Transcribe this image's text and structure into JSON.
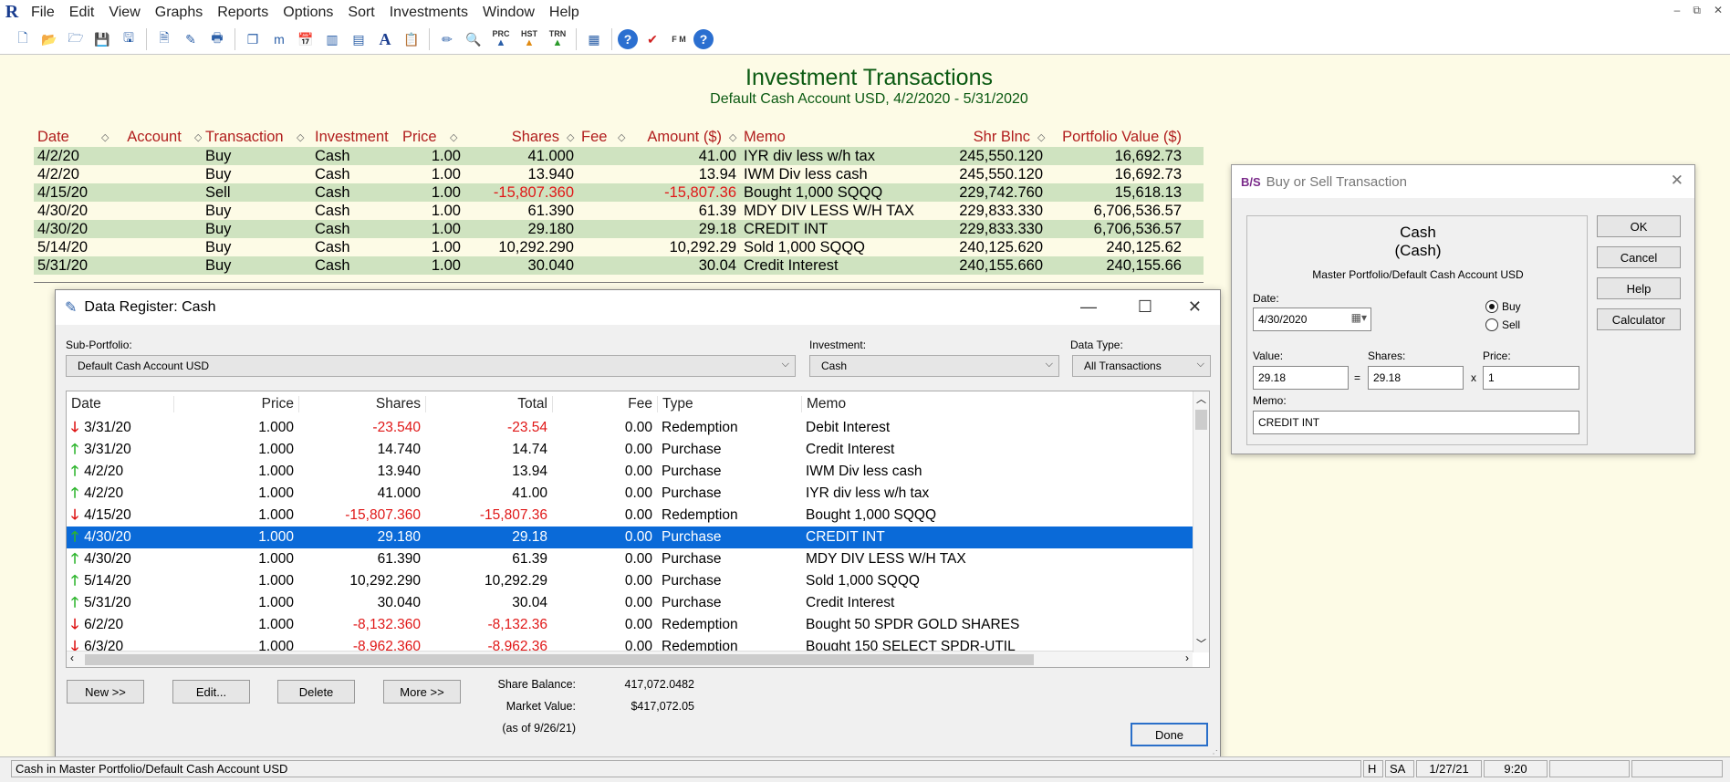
{
  "app": {
    "logo": "R",
    "menu": [
      "File",
      "Edit",
      "View",
      "Graphs",
      "Reports",
      "Options",
      "Sort",
      "Investments",
      "Window",
      "Help"
    ],
    "window_controls": [
      "–",
      "⧉",
      "✕"
    ]
  },
  "toolbar": {
    "labels": [
      "PRC",
      "HST",
      "TRN"
    ],
    "fm_label": "F M"
  },
  "report": {
    "title": "Investment Transactions",
    "subtitle": "Default Cash Account USD, 4/2/2020 - 5/31/2020",
    "columns": [
      "Date",
      "Account",
      "Transaction",
      "Investment",
      "Price",
      "Shares",
      "Fee",
      "Amount ($)",
      "Memo",
      "Shr Blnc",
      "Portfolio Value ($)"
    ],
    "rows": [
      {
        "date": "4/2/20",
        "account": "",
        "transaction": "Buy",
        "investment": "Cash",
        "price": "1.00",
        "shares": "41.000",
        "fee": "",
        "amount": "41.00",
        "memo": "IYR div less w/h tax",
        "shr_blnc": "245,550.120",
        "portfolio_value": "16,692.73"
      },
      {
        "date": "4/2/20",
        "account": "",
        "transaction": "Buy",
        "investment": "Cash",
        "price": "1.00",
        "shares": "13.940",
        "fee": "",
        "amount": "13.94",
        "memo": "IWM Div less cash",
        "shr_blnc": "245,550.120",
        "portfolio_value": "16,692.73"
      },
      {
        "date": "4/15/20",
        "account": "",
        "transaction": "Sell",
        "investment": "Cash",
        "price": "1.00",
        "shares": "-15,807.360",
        "fee": "",
        "amount": "-15,807.36",
        "memo": "Bought 1,000 SQQQ",
        "shr_blnc": "229,742.760",
        "portfolio_value": "15,618.13"
      },
      {
        "date": "4/30/20",
        "account": "",
        "transaction": "Buy",
        "investment": "Cash",
        "price": "1.00",
        "shares": "61.390",
        "fee": "",
        "amount": "61.39",
        "memo": "MDY DIV LESS W/H TAX",
        "shr_blnc": "229,833.330",
        "portfolio_value": "6,706,536.57"
      },
      {
        "date": "4/30/20",
        "account": "",
        "transaction": "Buy",
        "investment": "Cash",
        "price": "1.00",
        "shares": "29.180",
        "fee": "",
        "amount": "29.18",
        "memo": "CREDIT INT",
        "shr_blnc": "229,833.330",
        "portfolio_value": "6,706,536.57"
      },
      {
        "date": "5/14/20",
        "account": "",
        "transaction": "Buy",
        "investment": "Cash",
        "price": "1.00",
        "shares": "10,292.290",
        "fee": "",
        "amount": "10,292.29",
        "memo": "Sold 1,000 SQQQ",
        "shr_blnc": "240,125.620",
        "portfolio_value": "240,125.62"
      },
      {
        "date": "5/31/20",
        "account": "",
        "transaction": "Buy",
        "investment": "Cash",
        "price": "1.00",
        "shares": "30.040",
        "fee": "",
        "amount": "30.04",
        "memo": "Credit Interest",
        "shr_blnc": "240,155.660",
        "portfolio_value": "240,155.66"
      }
    ]
  },
  "register": {
    "title": "Data Register: Cash",
    "sub_portfolio_label": "Sub-Portfolio:",
    "sub_portfolio_value": "Default Cash Account USD",
    "investment_label": "Investment:",
    "investment_value": "Cash",
    "data_type_label": "Data Type:",
    "data_type_value": "All Transactions",
    "columns": [
      "Date",
      "Price",
      "Shares",
      "Total",
      "Fee",
      "Type",
      "Memo"
    ],
    "rows": [
      {
        "dir": "down",
        "date": "3/31/20",
        "price": "1.000",
        "shares": "-23.540",
        "total": "-23.54",
        "fee": "0.00",
        "type": "Redemption",
        "memo": "Debit Interest"
      },
      {
        "dir": "up",
        "date": "3/31/20",
        "price": "1.000",
        "shares": "14.740",
        "total": "14.74",
        "fee": "0.00",
        "type": "Purchase",
        "memo": "Credit Interest"
      },
      {
        "dir": "up",
        "date": "4/2/20",
        "price": "1.000",
        "shares": "13.940",
        "total": "13.94",
        "fee": "0.00",
        "type": "Purchase",
        "memo": "IWM Div less cash"
      },
      {
        "dir": "up",
        "date": "4/2/20",
        "price": "1.000",
        "shares": "41.000",
        "total": "41.00",
        "fee": "0.00",
        "type": "Purchase",
        "memo": "IYR div less w/h tax"
      },
      {
        "dir": "down",
        "date": "4/15/20",
        "price": "1.000",
        "shares": "-15,807.360",
        "total": "-15,807.36",
        "fee": "0.00",
        "type": "Redemption",
        "memo": "Bought 1,000 SQQQ"
      },
      {
        "dir": "up",
        "date": "4/30/20",
        "price": "1.000",
        "shares": "29.180",
        "total": "29.18",
        "fee": "0.00",
        "type": "Purchase",
        "memo": "CREDIT INT",
        "selected": true
      },
      {
        "dir": "up",
        "date": "4/30/20",
        "price": "1.000",
        "shares": "61.390",
        "total": "61.39",
        "fee": "0.00",
        "type": "Purchase",
        "memo": "MDY DIV LESS W/H TAX"
      },
      {
        "dir": "up",
        "date": "5/14/20",
        "price": "1.000",
        "shares": "10,292.290",
        "total": "10,292.29",
        "fee": "0.00",
        "type": "Purchase",
        "memo": "Sold 1,000 SQQQ"
      },
      {
        "dir": "up",
        "date": "5/31/20",
        "price": "1.000",
        "shares": "30.040",
        "total": "30.04",
        "fee": "0.00",
        "type": "Purchase",
        "memo": "Credit Interest"
      },
      {
        "dir": "down",
        "date": "6/2/20",
        "price": "1.000",
        "shares": "-8,132.360",
        "total": "-8,132.36",
        "fee": "0.00",
        "type": "Redemption",
        "memo": "Bought 50 SPDR GOLD SHARES"
      },
      {
        "dir": "down",
        "date": "6/3/20",
        "price": "1.000",
        "shares": "-8,962.360",
        "total": "-8,962.36",
        "fee": "0.00",
        "type": "Redemption",
        "memo": "Bought 150 SELECT SPDR-UTIL"
      }
    ],
    "buttons": {
      "new": "New >>",
      "edit": "Edit...",
      "delete": "Delete",
      "more": "More >>",
      "done": "Done"
    },
    "share_balance_label": "Share Balance:",
    "share_balance_value": "417,072.0482",
    "market_value_label": "Market Value:",
    "market_value_value": "$417,072.05",
    "as_of": "(as of 9/26/21)"
  },
  "buysell": {
    "title": "Buy or Sell Transaction",
    "heading": "Cash",
    "subheading": "(Cash)",
    "account": "Master Portfolio/Default Cash Account USD",
    "date_label": "Date:",
    "date_value": "4/30/2020",
    "buy_label": "Buy",
    "sell_label": "Sell",
    "selected": "Buy",
    "value_label": "Value:",
    "value_value": "29.18",
    "shares_label": "Shares:",
    "shares_value": "29.18",
    "price_label": "Price:",
    "price_value": "1",
    "equals": "=",
    "times": "x",
    "memo_label": "Memo:",
    "memo_value": "CREDIT INT",
    "buttons": {
      "ok": "OK",
      "cancel": "Cancel",
      "help": "Help",
      "calculator": "Calculator"
    }
  },
  "statusbar": {
    "text": "Cash in Master Portfolio/Default Cash Account USD",
    "h": "H",
    "sa": "SA",
    "date": "1/27/21",
    "time": "9:20"
  },
  "colors": {
    "report_bg": "#fdfbe6",
    "report_title": "#0b5a12",
    "header_red": "#b11d1d",
    "row_stripe": "#cfe3c0",
    "negative": "#e01818",
    "selection": "#0a6ad8"
  }
}
